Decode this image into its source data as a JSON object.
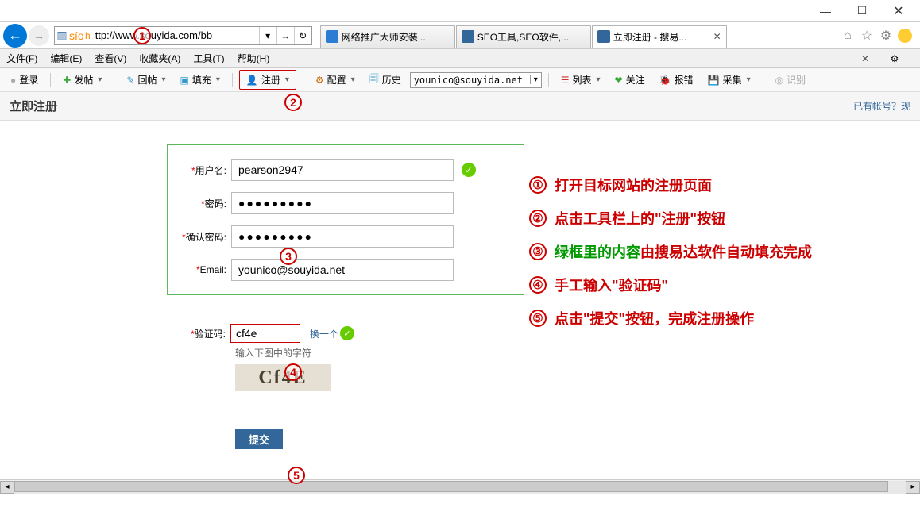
{
  "window": {
    "minimize": "—",
    "maximize": "☐",
    "close": "✕"
  },
  "nav": {
    "url": "ttp://www.souyida.com/bb",
    "tabs": [
      {
        "label": "网络推广大师安装..."
      },
      {
        "label": "SEO工具,SEO软件,..."
      },
      {
        "label": "立即注册 - 搜易..."
      }
    ]
  },
  "menu": {
    "file": "文件(F)",
    "edit": "编辑(E)",
    "view": "查看(V)",
    "fav": "收藏夹(A)",
    "tool": "工具(T)",
    "help": "帮助(H)"
  },
  "toolbar": {
    "login": "登录",
    "post": "发帖",
    "reply": "回帖",
    "fill": "填充",
    "register": "注册",
    "config": "配置",
    "history": "历史",
    "email": "younico@souyida.net",
    "list": "列表",
    "follow": "关注",
    "bug": "报错",
    "collect": "采集",
    "recog": "识别"
  },
  "page": {
    "title": "立即注册",
    "loginlink": "已有帐号？现"
  },
  "form": {
    "username_lbl": "用户名:",
    "username": "pearson2947",
    "password_lbl": "密码:",
    "password": "●●●●●●●●●",
    "confirm_lbl": "确认密码:",
    "confirm": "●●●●●●●●●",
    "email_lbl": "Email:",
    "email": "younico@souyida.net",
    "captcha_lbl": "验证码:",
    "captcha": "cf4e",
    "captcha_change": "换一个",
    "captcha_tip": "输入下图中的字符",
    "captcha_img": "Cf4E",
    "submit": "提交"
  },
  "instructions": {
    "l1a": "打开目标网站的注册页面",
    "l2a": "点击工具栏上的\"注册\"按钮",
    "l3a": "绿框里的内容",
    "l3b": "由搜易达软件自动填充完成",
    "l4a": "手工输入\"验证码\"",
    "l5a": "点击\"提交\"按钮，完成注册操作"
  },
  "circles": {
    "c1": "1",
    "c2": "2",
    "c3": "3",
    "c4": "4",
    "c5": "5"
  }
}
